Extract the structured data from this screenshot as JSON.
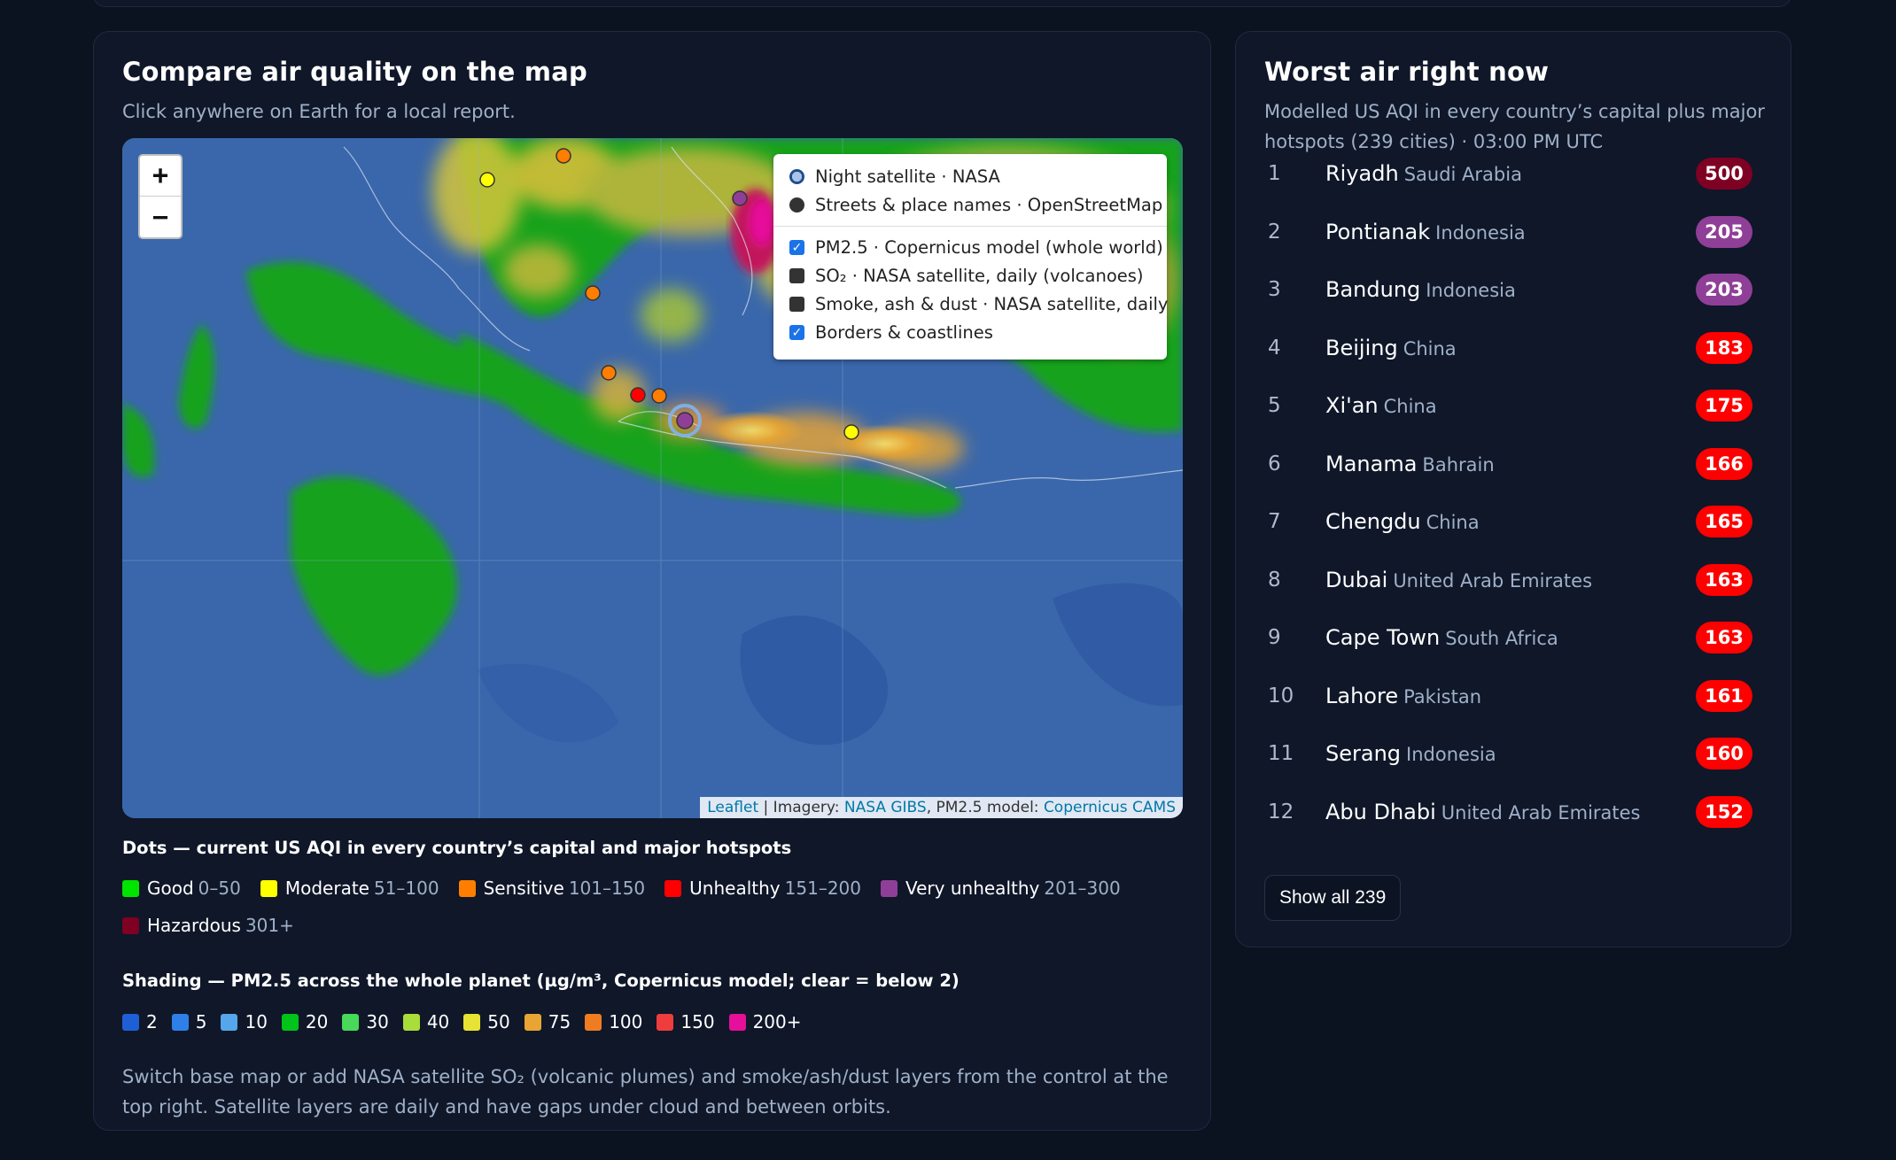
{
  "map_card": {
    "title": "Compare air quality on the map",
    "subtitle": "Click anywhere on Earth for a local report.",
    "zoom_in": "+",
    "zoom_out": "−",
    "layers": {
      "base": [
        {
          "label": "Night satellite · NASA",
          "selected": true
        },
        {
          "label": "Streets & place names · OpenStreetMap",
          "selected": false
        }
      ],
      "overlays": [
        {
          "label": "PM2.5 · Copernicus model (whole world)",
          "checked": true
        },
        {
          "label": "SO₂ · NASA satellite, daily (volcanoes)",
          "checked": false
        },
        {
          "label": "Smoke, ash & dust · NASA satellite, daily",
          "checked": false
        },
        {
          "label": "Borders & coastlines",
          "checked": true
        }
      ]
    },
    "attribution": {
      "leaflet": "Leaflet",
      "sep1": " | Imagery: ",
      "gibs": "NASA GIBS",
      "sep2": ", PM2.5 model: ",
      "cams": "Copernicus CAMS"
    },
    "dots_legend": {
      "title": "Dots — current US AQI in every country’s capital and major hotspots",
      "items": [
        {
          "name": "Good",
          "range": "0–50",
          "color": "#00e400"
        },
        {
          "name": "Moderate",
          "range": "51–100",
          "color": "#ffff00"
        },
        {
          "name": "Sensitive",
          "range": "101–150",
          "color": "#ff7e00"
        },
        {
          "name": "Unhealthy",
          "range": "151–200",
          "color": "#ff0000"
        },
        {
          "name": "Very unhealthy",
          "range": "201–300",
          "color": "#8f3f97"
        },
        {
          "name": "Hazardous",
          "range": "301+",
          "color": "#7e0023"
        }
      ]
    },
    "shading_legend": {
      "title": "Shading — PM2.5 across the whole planet (µg/m³, Copernicus model; clear = below 2)",
      "items": [
        {
          "label": "2",
          "color": "#1f5fd6"
        },
        {
          "label": "5",
          "color": "#2f7fe8"
        },
        {
          "label": "10",
          "color": "#56a6ec"
        },
        {
          "label": "20",
          "color": "#00c41a"
        },
        {
          "label": "30",
          "color": "#48d85a"
        },
        {
          "label": "40",
          "color": "#a8dd3a"
        },
        {
          "label": "50",
          "color": "#e7e332"
        },
        {
          "label": "75",
          "color": "#e8a533"
        },
        {
          "label": "100",
          "color": "#f07c22"
        },
        {
          "label": "150",
          "color": "#ef3d3d"
        },
        {
          "label": "200+",
          "color": "#e60f9a"
        }
      ]
    },
    "footnote": "Switch base map or add NASA satellite SO₂ (volcanic plumes) and smoke/ash/dust layers from the control at the top right. Satellite layers are daily and have gaps under cloud and between orbits.",
    "markers": [
      {
        "aqi_class": "moderate",
        "color": "#ffff00"
      },
      {
        "aqi_class": "sensitive",
        "color": "#ff7e00"
      },
      {
        "aqi_class": "very-unhealthy",
        "color": "#8f3f97"
      },
      {
        "aqi_class": "sensitive",
        "color": "#ff7e00"
      },
      {
        "aqi_class": "sensitive",
        "color": "#ff7e00"
      },
      {
        "aqi_class": "unhealthy",
        "color": "#ff0000"
      },
      {
        "aqi_class": "sensitive",
        "color": "#ff7e00"
      },
      {
        "aqi_class": "very-unhealthy",
        "color": "#8f3f97",
        "selected": true
      },
      {
        "aqi_class": "moderate",
        "color": "#ffff00"
      }
    ]
  },
  "worst_card": {
    "title": "Worst air right now",
    "subtitle_line1": "Modelled US AQI in every country’s capital plus major",
    "subtitle_line2": "hotspots (239 cities) · 03:00 PM UTC",
    "show_all": "Show all 239",
    "rows": [
      {
        "rank": "1",
        "city": "Riyadh",
        "country": "Saudi Arabia",
        "aqi": "500",
        "color": "#7e0023"
      },
      {
        "rank": "2",
        "city": "Pontianak",
        "country": "Indonesia",
        "aqi": "205",
        "color": "#8f3f97"
      },
      {
        "rank": "3",
        "city": "Bandung",
        "country": "Indonesia",
        "aqi": "203",
        "color": "#8f3f97"
      },
      {
        "rank": "4",
        "city": "Beijing",
        "country": "China",
        "aqi": "183",
        "color": "#ff0000"
      },
      {
        "rank": "5",
        "city": "Xi'an",
        "country": "China",
        "aqi": "175",
        "color": "#ff0000"
      },
      {
        "rank": "6",
        "city": "Manama",
        "country": "Bahrain",
        "aqi": "166",
        "color": "#ff0000"
      },
      {
        "rank": "7",
        "city": "Chengdu",
        "country": "China",
        "aqi": "165",
        "color": "#ff0000"
      },
      {
        "rank": "8",
        "city": "Dubai",
        "country": "United Arab Emirates",
        "aqi": "163",
        "color": "#ff0000"
      },
      {
        "rank": "9",
        "city": "Cape Town",
        "country": "South Africa",
        "aqi": "163",
        "color": "#ff0000"
      },
      {
        "rank": "10",
        "city": "Lahore",
        "country": "Pakistan",
        "aqi": "161",
        "color": "#ff0000"
      },
      {
        "rank": "11",
        "city": "Serang",
        "country": "Indonesia",
        "aqi": "160",
        "color": "#ff0000"
      },
      {
        "rank": "12",
        "city": "Abu Dhabi",
        "country": "United Arab Emirates",
        "aqi": "152",
        "color": "#ff0000"
      }
    ]
  }
}
